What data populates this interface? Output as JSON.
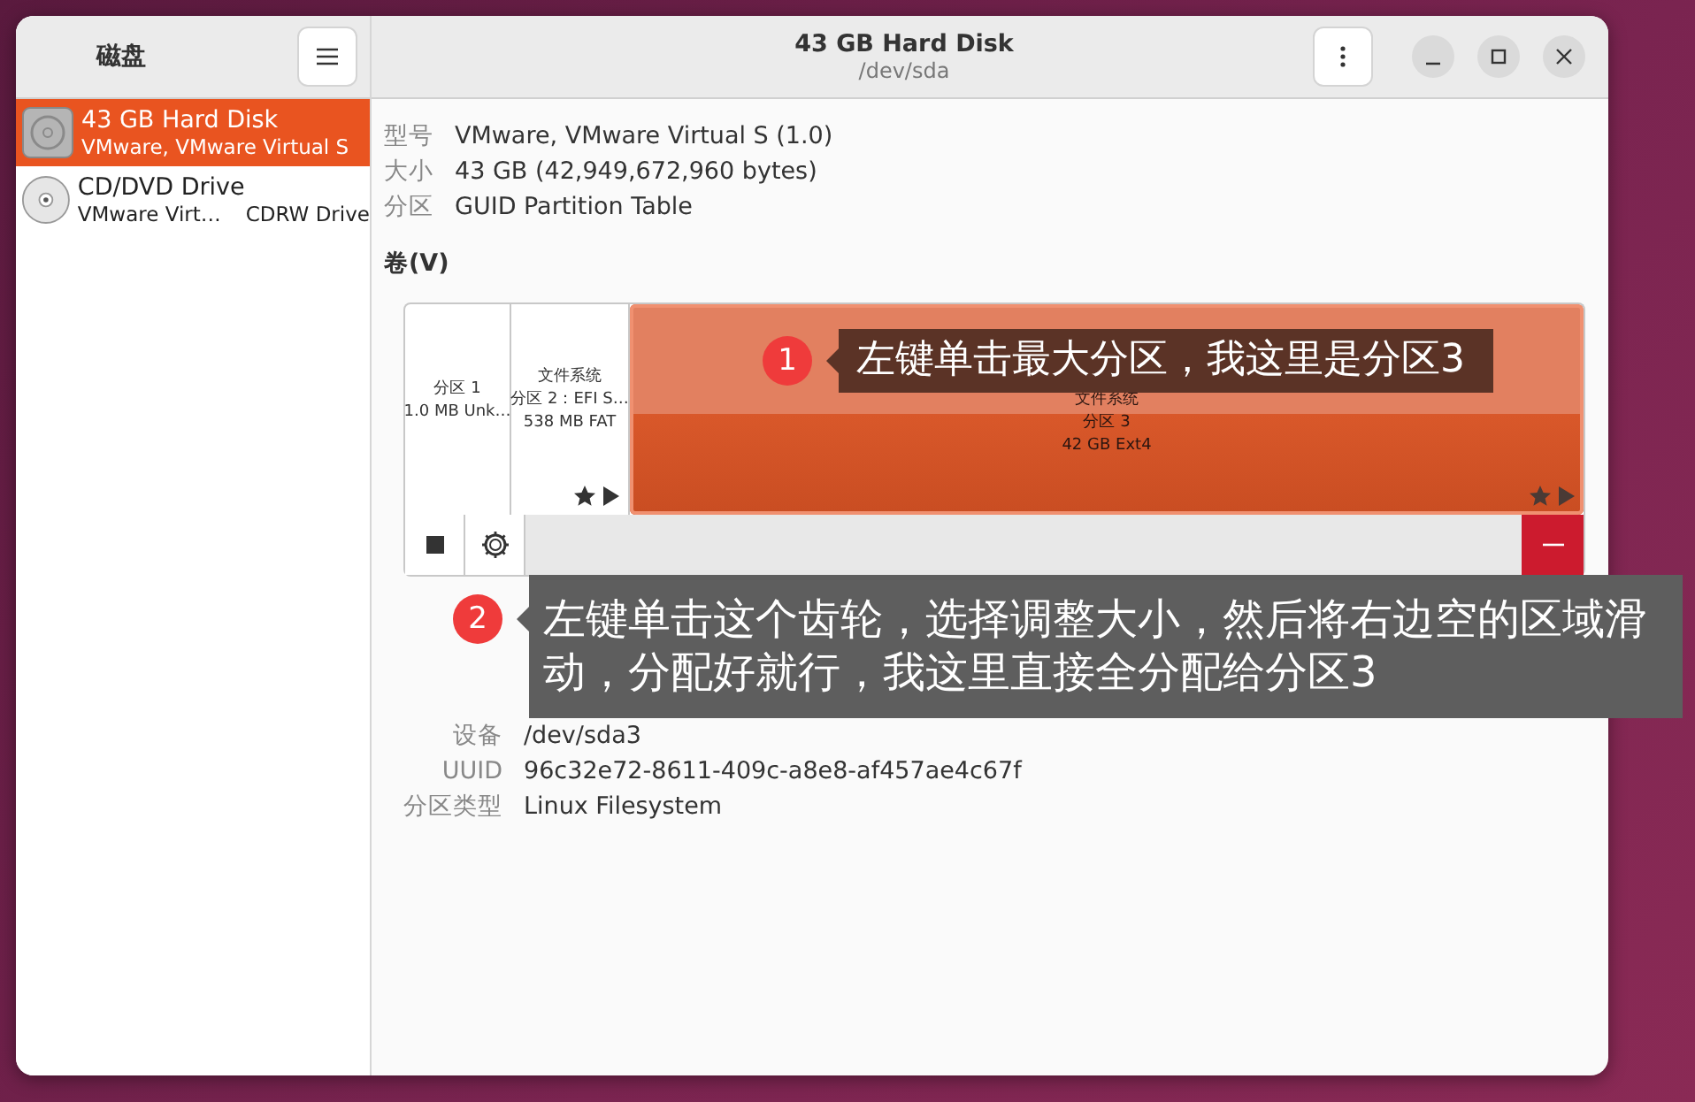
{
  "window": {
    "title": "43 GB Hard Disk",
    "subtitle": "/dev/sda"
  },
  "sidebar": {
    "title": "磁盘",
    "items": [
      {
        "name": "43 GB Hard Disk",
        "detail": "VMware, VMware Virtual S",
        "kind": "hdd",
        "selected": true
      },
      {
        "name": "CD/DVD Drive",
        "detail": "VMware Virt…",
        "detail_2": "CDRW Drive",
        "kind": "optical",
        "selected": false
      }
    ]
  },
  "drive_info": [
    {
      "label": "型号",
      "value": "VMware, VMware Virtual S (1.0)"
    },
    {
      "label": "大小",
      "value": "43 GB (42,949,672,960 bytes)"
    },
    {
      "label": "分区",
      "value": "GUID Partition Table"
    }
  ],
  "volumes": {
    "title": "卷(V)",
    "partitions": [
      {
        "lines": [
          "分区 1",
          "1.0 MB Unk…"
        ],
        "selected": false,
        "badges": false
      },
      {
        "lines": [
          "文件系统",
          "分区 2：EFI S…",
          "538 MB FAT"
        ],
        "selected": false,
        "badges": true
      },
      {
        "lines": [
          "文件系统",
          "分区 3",
          "42 GB Ext4"
        ],
        "selected": true,
        "badges": true
      }
    ]
  },
  "volume_info": [
    {
      "label": "设备",
      "value": "/dev/sda3"
    },
    {
      "label": "UUID",
      "value": "96c32e72-8611-409c-a8e8-af457ae4c67f"
    },
    {
      "label": "分区类型",
      "value": "Linux Filesystem"
    }
  ],
  "callouts": [
    {
      "number": "1",
      "text": "左键单击最大分区，我这里是分区3"
    },
    {
      "number": "2",
      "text": "左键单击这个齿轮，选择调整大小，然后将右边空的区域滑动，分配好就行，我这里直接全分配给分区3"
    }
  ]
}
